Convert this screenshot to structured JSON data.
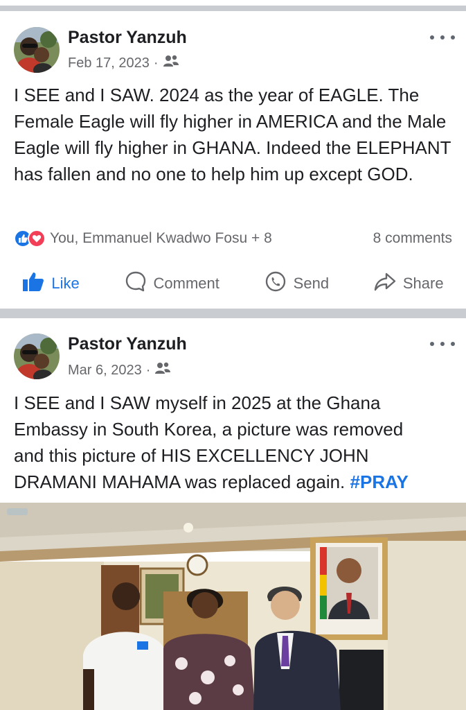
{
  "posts": [
    {
      "author": "Pastor Yanzuh",
      "date": "Feb 17, 2023",
      "separator": "·",
      "audience_icon": "friends-icon",
      "text": "I SEE and I SAW. 2024 as the year of EAGLE. The Female Eagle will fly higher in AMERICA and the Male Eagle will fly higher in GHANA. Indeed the ELEPHANT has fallen and no one to help him up except GOD.",
      "reactions": {
        "icons": [
          "like-reaction-icon",
          "love-reaction-icon"
        ],
        "summary": "You, Emmanuel Kwadwo Fosu + 8",
        "comments": "8 comments"
      },
      "actions": {
        "like": "Like",
        "comment": "Comment",
        "send": "Send",
        "share": "Share"
      }
    },
    {
      "author": "Pastor Yanzuh",
      "date": "Mar 6, 2023",
      "separator": "·",
      "audience_icon": "friends-icon",
      "text_lines": [
        "I SEE and I SAW myself in 2025 at the Ghana",
        "Embassy in South Korea, a picture was removed",
        "and this picture of HIS EXCELLENCY JOHN",
        "DRAMANI MAHAMA was replaced again."
      ],
      "hashtag": "#PRAY"
    }
  ],
  "colors": {
    "accent": "#1b74e4",
    "meta_text": "#65676b",
    "divider": "#c9ccd1",
    "love_red": "#f33e58"
  }
}
